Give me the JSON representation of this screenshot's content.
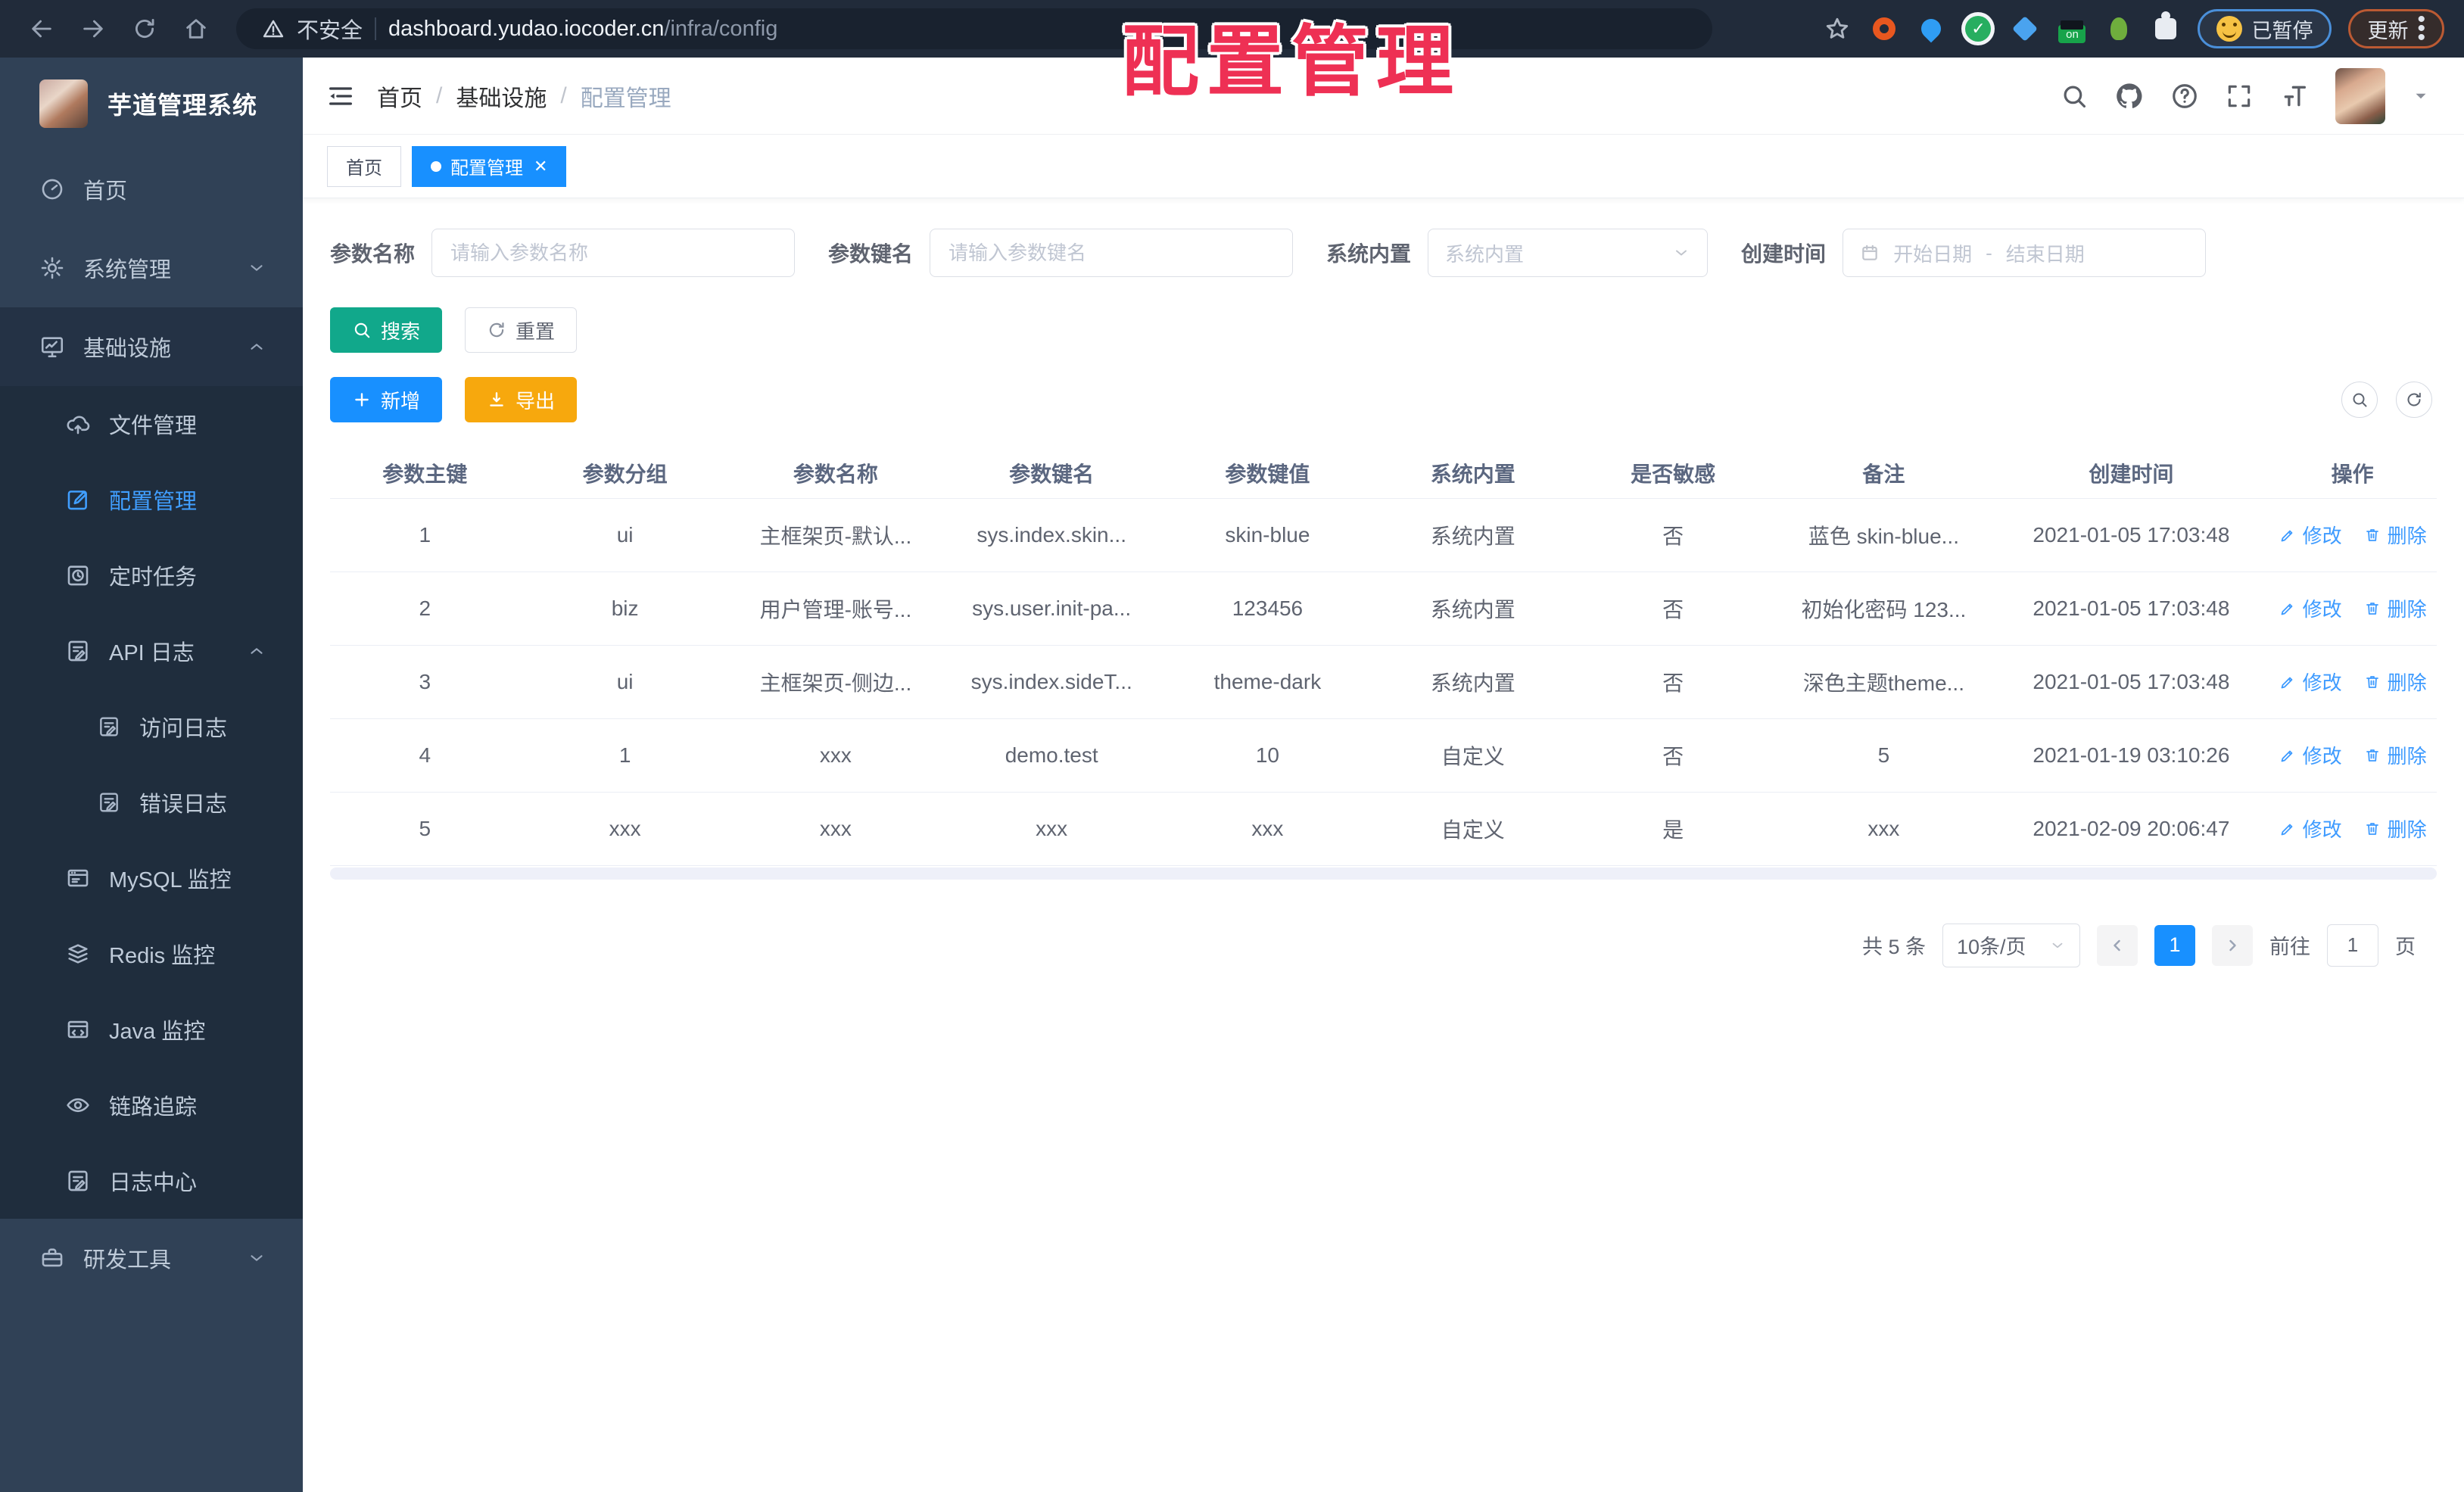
{
  "watermark": "配置管理",
  "browser": {
    "security_label": "不安全",
    "url_host": "dashboard.yudao.iocoder.cn",
    "url_path": "/infra/config",
    "paused_badge": "已暂停",
    "update_button": "更新"
  },
  "sidebar": {
    "app_title": "芋道管理系统",
    "items": [
      {
        "label": "首页",
        "icon": "gauge-icon"
      },
      {
        "label": "系统管理",
        "icon": "gear-icon",
        "chevron": "down"
      },
      {
        "label": "基础设施",
        "icon": "monitor-icon",
        "chevron": "up",
        "expanded": true
      },
      {
        "label": "文件管理",
        "icon": "cloud-upload-icon",
        "level": 2
      },
      {
        "label": "配置管理",
        "icon": "edit-square-icon",
        "level": 2,
        "active": true
      },
      {
        "label": "定时任务",
        "icon": "timer-icon",
        "level": 2
      },
      {
        "label": "API 日志",
        "icon": "doc-edit-icon",
        "level": 2,
        "chevron": "up"
      },
      {
        "label": "访问日志",
        "icon": "doc-edit-icon",
        "level": 3
      },
      {
        "label": "错误日志",
        "icon": "doc-edit-icon",
        "level": 3
      },
      {
        "label": "MySQL 监控",
        "icon": "window-icon",
        "level": 2
      },
      {
        "label": "Redis 监控",
        "icon": "layers-icon",
        "level": 2
      },
      {
        "label": "Java 监控",
        "icon": "window-icon",
        "level": 2
      },
      {
        "label": "链路追踪",
        "icon": "eye-icon",
        "level": 2
      },
      {
        "label": "日志中心",
        "icon": "doc-edit-icon",
        "level": 2
      },
      {
        "label": "研发工具",
        "icon": "briefcase-icon",
        "chevron": "down"
      }
    ]
  },
  "breadcrumb": {
    "separator": "/",
    "items": [
      "首页",
      "基础设施",
      "配置管理"
    ]
  },
  "tabs": [
    {
      "label": "首页",
      "active": false
    },
    {
      "label": "配置管理",
      "active": true
    }
  ],
  "filters": {
    "name_label": "参数名称",
    "name_placeholder": "请输入参数名称",
    "key_label": "参数键名",
    "key_placeholder": "请输入参数键名",
    "type_label": "系统内置",
    "type_placeholder": "系统内置",
    "date_label": "创建时间",
    "date_start_placeholder": "开始日期",
    "date_separator": "-",
    "date_end_placeholder": "结束日期"
  },
  "toolbar": {
    "search": "搜索",
    "reset": "重置",
    "add": "新增",
    "export": "导出"
  },
  "table": {
    "columns": [
      "参数主键",
      "参数分组",
      "参数名称",
      "参数键名",
      "参数键值",
      "系统内置",
      "是否敏感",
      "备注",
      "创建时间",
      "操作"
    ],
    "rows": [
      [
        "1",
        "ui",
        "主框架页-默认...",
        "sys.index.skin...",
        "skin-blue",
        "系统内置",
        "否",
        "蓝色 skin-blue...",
        "2021-01-05 17:03:48"
      ],
      [
        "2",
        "biz",
        "用户管理-账号...",
        "sys.user.init-pa...",
        "123456",
        "系统内置",
        "否",
        "初始化密码 123...",
        "2021-01-05 17:03:48"
      ],
      [
        "3",
        "ui",
        "主框架页-侧边...",
        "sys.index.sideT...",
        "theme-dark",
        "系统内置",
        "否",
        "深色主题theme...",
        "2021-01-05 17:03:48"
      ],
      [
        "4",
        "1",
        "xxx",
        "demo.test",
        "10",
        "自定义",
        "否",
        "5",
        "2021-01-19 03:10:26"
      ],
      [
        "5",
        "xxx",
        "xxx",
        "xxx",
        "xxx",
        "自定义",
        "是",
        "xxx",
        "2021-02-09 20:06:47"
      ]
    ],
    "edit_label": "修改",
    "delete_label": "删除"
  },
  "pagination": {
    "total": "共 5 条",
    "page_size": "10条/页",
    "current_page": "1",
    "goto_label": "前往",
    "goto_value": "1",
    "page_unit": "页"
  },
  "colors": {
    "primary": "#1890ff",
    "success": "#11a88b",
    "warning": "#f7a80d",
    "sidebar_bg": "#304156",
    "submenu_bg": "#1f2d3d",
    "active_link": "#409eff",
    "watermark": "#ee3054",
    "browser_bar": "#212b3a"
  }
}
